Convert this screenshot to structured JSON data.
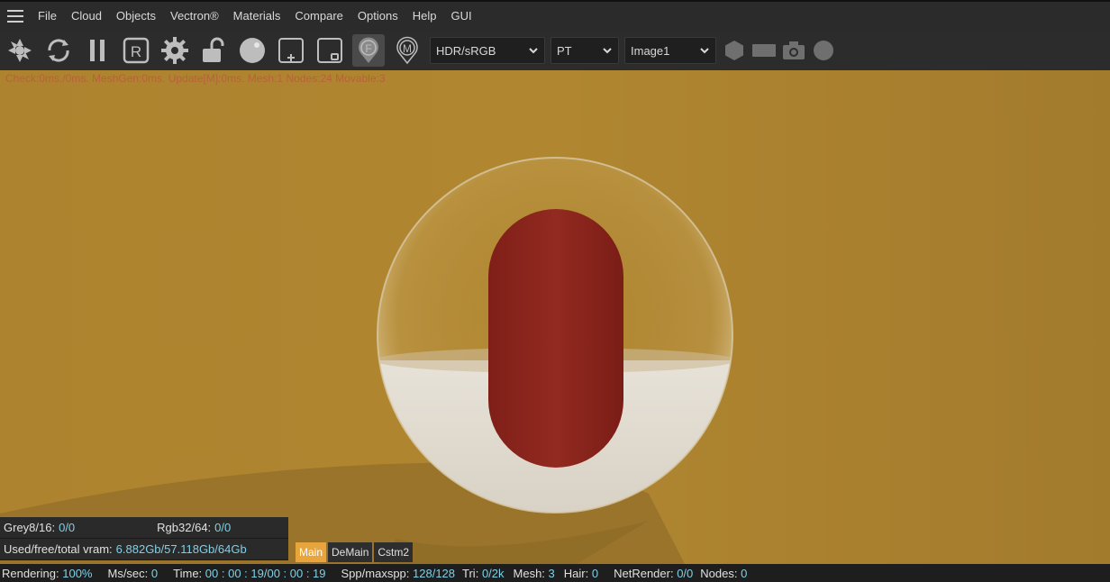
{
  "menu": {
    "items": [
      "File",
      "Cloud",
      "Objects",
      "Vectron®",
      "Materials",
      "Compare",
      "Options",
      "Help",
      "GUI"
    ]
  },
  "toolbar": {
    "icons": [
      "aperture-icon",
      "refresh-icon",
      "pause-icon",
      "render-r-icon",
      "gear-icon",
      "unlock-icon",
      "sphere-icon",
      "region-add-icon",
      "region-select-icon",
      "focus-pick-icon",
      "material-pick-icon"
    ],
    "colorspace": "HDR/sRGB",
    "kernel": "PT",
    "image": "Image1"
  },
  "viewport": {
    "stats": "Check:0ms./0ms. MeshGen:0ms. Update[M]:0ms. Mesh:1 Nodes:24 Movable:3",
    "background_color": "#a77e2e"
  },
  "info": {
    "grey_label": "Grey8/16:",
    "grey_value": "0/0",
    "rgb_label": "Rgb32/64:",
    "rgb_value": "0/0",
    "vram_label": "Used/free/total vram:",
    "vram_value": "6.882Gb/57.118Gb/64Gb"
  },
  "view_tabs": [
    "Main",
    "DeMain",
    "Cstm2"
  ],
  "status": {
    "rendering_label": "Rendering:",
    "rendering_value": "100%",
    "ms_label": "Ms/sec:",
    "ms_value": "0",
    "time_label": "Time:",
    "time_value": "00 : 00 : 19/00 : 00 : 19",
    "spp_label": "Spp/maxspp:",
    "spp_value": "128/128",
    "tri_label": "Tri:",
    "tri_value": "0/2k",
    "mesh_label": "Mesh:",
    "mesh_value": "3",
    "hair_label": "Hair:",
    "hair_value": "0",
    "net_label": "NetRender:",
    "net_value": "0/0",
    "nodes_label": "Nodes:",
    "nodes_value": "0"
  },
  "colors": {
    "accent": "#e8a53e",
    "value_text": "#7fd0e6",
    "stats_text": "#b9613a",
    "capsule": "#8e231c"
  }
}
